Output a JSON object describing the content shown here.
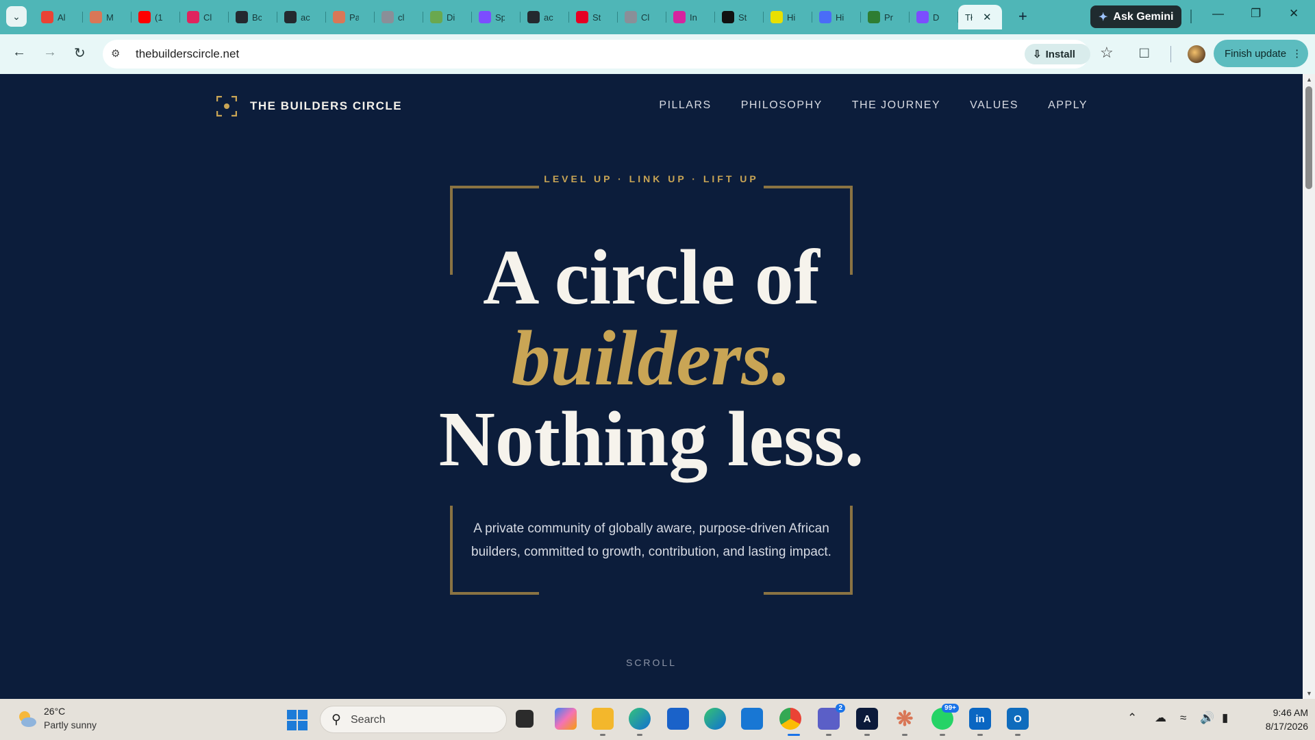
{
  "browser": {
    "tabs": [
      {
        "label": "Al",
        "icon": "gmail-icon",
        "color": "#ea4335"
      },
      {
        "label": "M",
        "icon": "asterisk-icon",
        "color": "#d97757"
      },
      {
        "label": "(1",
        "icon": "youtube-icon",
        "color": "#ff0000"
      },
      {
        "label": "Cl",
        "icon": "sk-icon",
        "color": "#e0245e"
      },
      {
        "label": "Bc",
        "icon": "github-icon",
        "color": "#24292f"
      },
      {
        "label": "ac",
        "icon": "github-icon",
        "color": "#24292f"
      },
      {
        "label": "Pa",
        "icon": "asterisk-icon",
        "color": "#d97757"
      },
      {
        "label": "cl",
        "icon": "globe-icon",
        "color": "#8a8f98"
      },
      {
        "label": "Di",
        "icon": "app-icon",
        "color": "#6aa84f"
      },
      {
        "label": "Sp",
        "icon": "spiral-icon",
        "color": "#7c4dff"
      },
      {
        "label": "ac",
        "icon": "github-icon",
        "color": "#24292f"
      },
      {
        "label": "St",
        "icon": "pinterest-icon",
        "color": "#e60023"
      },
      {
        "label": "Cl",
        "icon": "globe-icon",
        "color": "#8a8f98"
      },
      {
        "label": "In",
        "icon": "instagram-icon",
        "color": "#d6249f"
      },
      {
        "label": "St",
        "icon": "triangle-icon",
        "color": "#111111"
      },
      {
        "label": "Hi",
        "icon": "app-icon",
        "color": "#e8e000"
      },
      {
        "label": "Hi",
        "icon": "a-icon",
        "color": "#4a6cf7"
      },
      {
        "label": "Pr",
        "icon": "doc-icon",
        "color": "#2e7d32"
      },
      {
        "label": "D",
        "icon": "bolt-icon",
        "color": "#7c4dff"
      },
      {
        "label": "Tł",
        "icon": "",
        "color": "#e8f7f7",
        "active": true
      }
    ],
    "ask_gemini_label": "Ask Gemini",
    "url": "thebuilderscircle.net",
    "install_label": "Install",
    "finish_update_label": "Finish update"
  },
  "site": {
    "brand": "THE BUILDERS CIRCLE",
    "nav": [
      "PILLARS",
      "PHILOSOPHY",
      "THE JOURNEY",
      "VALUES",
      "APPLY"
    ],
    "tagline": "LEVEL UP · LINK UP · LIFT UP",
    "headline_line1": "A circle of",
    "headline_line2": "builders.",
    "headline_line3": "Nothing less.",
    "subtext": "A private community of globally aware, purpose-driven African builders, committed to growth, contribution, and lasting impact.",
    "scroll_label": "SCROLL",
    "accent_color": "#c9a555",
    "background_color": "#0c1d3b"
  },
  "taskbar": {
    "weather_temp": "26°C",
    "weather_condition": "Partly sunny",
    "search_placeholder": "Search",
    "teams_badge": "2",
    "whatsapp_badge": "99+",
    "time": "9:46 AM",
    "date": "8/17/2026"
  }
}
